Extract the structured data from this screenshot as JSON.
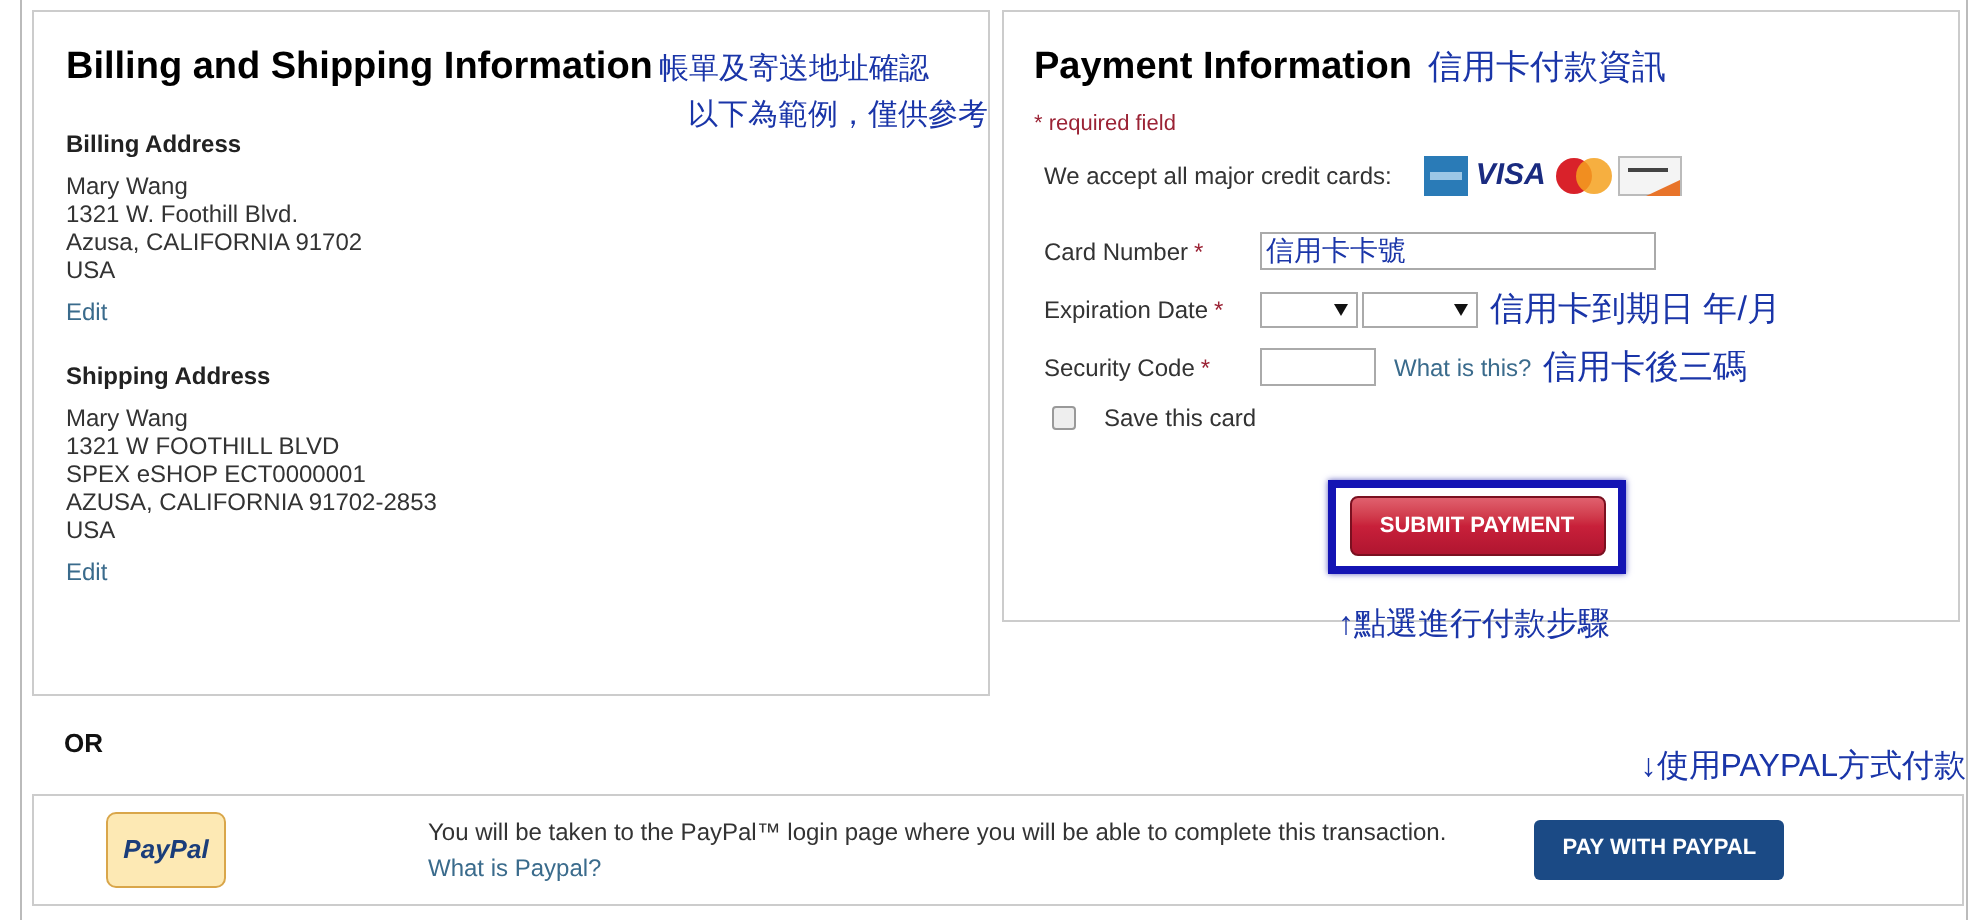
{
  "billing_section": {
    "title": "Billing and Shipping Information",
    "note": "帳單及寄送地址確認",
    "note_2": "以下為範例，僅供參考",
    "addresses": [
      {
        "heading": "Billing Address",
        "lines": [
          "Mary Wang",
          "1321 W. Foothill Blvd.",
          "Azusa, CALIFORNIA 91702",
          "USA"
        ],
        "edit": "Edit"
      },
      {
        "heading": "Shipping Address",
        "lines": [
          "Mary Wang",
          "1321 W FOOTHILL BLVD",
          "SPEX eSHOP ECT0000001",
          "AZUSA, CALIFORNIA 91702-2853",
          "USA"
        ],
        "edit": "Edit"
      }
    ]
  },
  "payment_section": {
    "title": "Payment Information",
    "note": "信用卡付款資訊",
    "required_note": "* required field",
    "cards_label": "We accept all major credit cards:",
    "visa_logo": "VISA",
    "fields": [
      {
        "kind": "text",
        "label": "Card Number",
        "required_mark": "*",
        "value": "信用卡卡號"
      },
      {
        "kind": "date",
        "label": "Expiration Date",
        "required_mark": "*",
        "note": "信用卡到期日 年/月"
      },
      {
        "kind": "code",
        "label": "Security Code",
        "required_mark": "*",
        "link": "What is this?",
        "note": "信用卡後三碼"
      }
    ],
    "save_card": {
      "label": "Save this card",
      "checked": false
    },
    "submit_button": "SUBMIT PAYMENT",
    "submit_note": "↑點選進行付款步驟"
  },
  "or_label": "OR",
  "paypal": {
    "logo": "PayPal",
    "message": "You will be taken to the PayPal™ login page where you will be able to complete this transaction.",
    "link": "What is Paypal?",
    "button": "PAY WITH PAYPAL",
    "note": "↓使用PAYPAL方式付款"
  }
}
